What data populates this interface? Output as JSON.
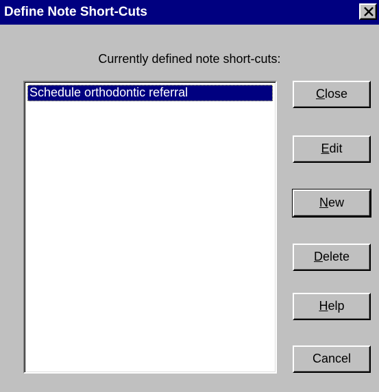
{
  "window": {
    "title": "Define Note Short-Cuts",
    "close_icon": "close-icon"
  },
  "caption": "Currently defined note short-cuts:",
  "list": {
    "items": [
      {
        "label": "Schedule orthodontic referral",
        "selected": true
      }
    ]
  },
  "buttons": [
    {
      "mnemonic": "C",
      "rest": "lose"
    },
    {
      "mnemonic": "E",
      "rest": "dit"
    },
    {
      "mnemonic": "N",
      "rest": "ew"
    },
    {
      "mnemonic": "D",
      "rest": "elete"
    },
    {
      "mnemonic": "H",
      "rest": "elp"
    },
    {
      "mnemonic": "",
      "rest": "Cancel"
    }
  ],
  "colors": {
    "titlebar": "#000080",
    "face": "#c0c0c0",
    "selection": "#000080"
  }
}
